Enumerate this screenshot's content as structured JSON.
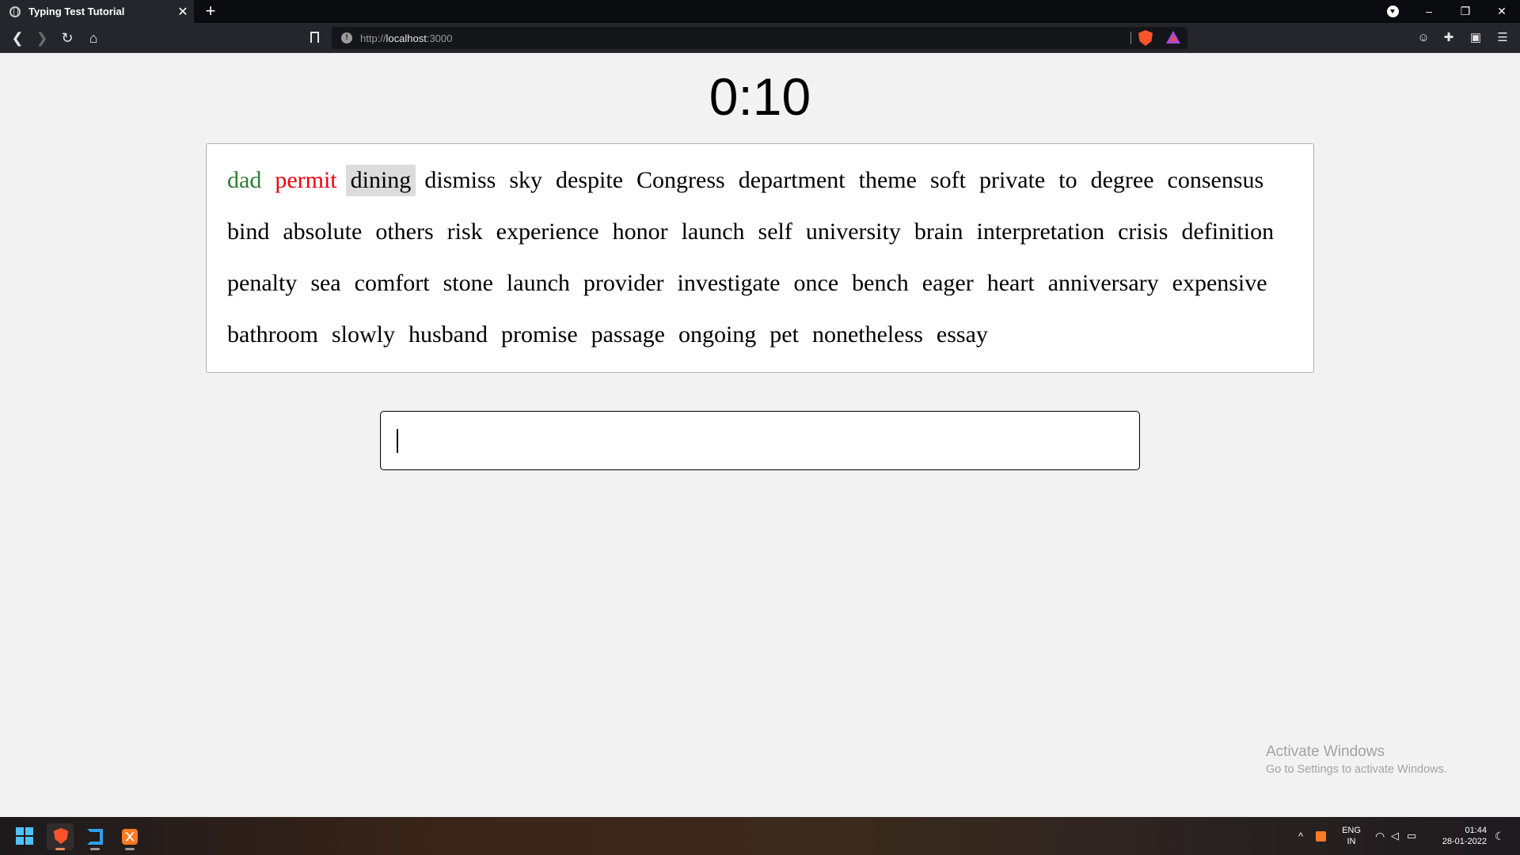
{
  "browser": {
    "tab_title": "Typing Test Tutorial",
    "tab_close": "✕",
    "new_tab": "+",
    "url_scheme": "http://",
    "url_host": "localhost",
    "url_port": ":3000",
    "window_controls": {
      "minimize": "–",
      "maximize": "❐",
      "close": "✕"
    },
    "nav": {
      "back": "❮",
      "forward": "❯",
      "reload": "↻",
      "home": "⌂"
    }
  },
  "timer": {
    "text": "0:10"
  },
  "words": {
    "correct_color": "#2e7d32",
    "incorrect_color": "#f0000f",
    "current_bg": "#dcdcdc",
    "items": [
      {
        "text": "dad",
        "state": "correct"
      },
      {
        "text": "permit",
        "state": "incorrect"
      },
      {
        "text": "dining",
        "state": "current"
      },
      {
        "text": "dismiss",
        "state": "pending"
      },
      {
        "text": "sky",
        "state": "pending"
      },
      {
        "text": "despite",
        "state": "pending"
      },
      {
        "text": "Congress",
        "state": "pending"
      },
      {
        "text": "department",
        "state": "pending"
      },
      {
        "text": "theme",
        "state": "pending"
      },
      {
        "text": "soft",
        "state": "pending"
      },
      {
        "text": "private",
        "state": "pending"
      },
      {
        "text": "to",
        "state": "pending"
      },
      {
        "text": "degree",
        "state": "pending"
      },
      {
        "text": "consensus",
        "state": "pending"
      },
      {
        "text": "bind",
        "state": "pending"
      },
      {
        "text": "absolute",
        "state": "pending"
      },
      {
        "text": "others",
        "state": "pending"
      },
      {
        "text": "risk",
        "state": "pending"
      },
      {
        "text": "experience",
        "state": "pending"
      },
      {
        "text": "honor",
        "state": "pending"
      },
      {
        "text": "launch",
        "state": "pending"
      },
      {
        "text": "self",
        "state": "pending"
      },
      {
        "text": "university",
        "state": "pending"
      },
      {
        "text": "brain",
        "state": "pending"
      },
      {
        "text": "interpretation",
        "state": "pending"
      },
      {
        "text": "crisis",
        "state": "pending"
      },
      {
        "text": "definition",
        "state": "pending"
      },
      {
        "text": "penalty",
        "state": "pending"
      },
      {
        "text": "sea",
        "state": "pending"
      },
      {
        "text": "comfort",
        "state": "pending"
      },
      {
        "text": "stone",
        "state": "pending"
      },
      {
        "text": "launch",
        "state": "pending"
      },
      {
        "text": "provider",
        "state": "pending"
      },
      {
        "text": "investigate",
        "state": "pending"
      },
      {
        "text": "once",
        "state": "pending"
      },
      {
        "text": "bench",
        "state": "pending"
      },
      {
        "text": "eager",
        "state": "pending"
      },
      {
        "text": "heart",
        "state": "pending"
      },
      {
        "text": "anniversary",
        "state": "pending"
      },
      {
        "text": "expensive",
        "state": "pending"
      },
      {
        "text": "bathroom",
        "state": "pending"
      },
      {
        "text": "slowly",
        "state": "pending"
      },
      {
        "text": "husband",
        "state": "pending"
      },
      {
        "text": "promise",
        "state": "pending"
      },
      {
        "text": "passage",
        "state": "pending"
      },
      {
        "text": "ongoing",
        "state": "pending"
      },
      {
        "text": "pet",
        "state": "pending"
      },
      {
        "text": "nonetheless",
        "state": "pending"
      },
      {
        "text": "essay",
        "state": "pending"
      }
    ]
  },
  "input": {
    "value": ""
  },
  "watermark": {
    "title": "Activate Windows",
    "subtitle": "Go to Settings to activate Windows."
  },
  "taskbar": {
    "language_line1": "ENG",
    "language_line2": "IN",
    "time": "01:44",
    "date": "28-01-2022"
  }
}
